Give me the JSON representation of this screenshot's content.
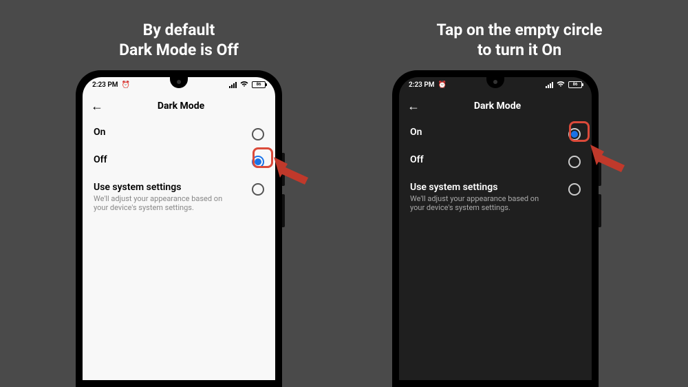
{
  "captions": {
    "left_line1": "By default",
    "left_line2": "Dark Mode is Off",
    "right_line1": "Tap on the empty circle",
    "right_line2": "to turn it On"
  },
  "statusbar": {
    "time": "2:23 PM",
    "battery": "86"
  },
  "page": {
    "title": "Dark Mode",
    "options": {
      "on": "On",
      "off": "Off",
      "system_title": "Use system settings",
      "system_sub": "We'll adjust your appearance based on your device's system settings."
    }
  }
}
